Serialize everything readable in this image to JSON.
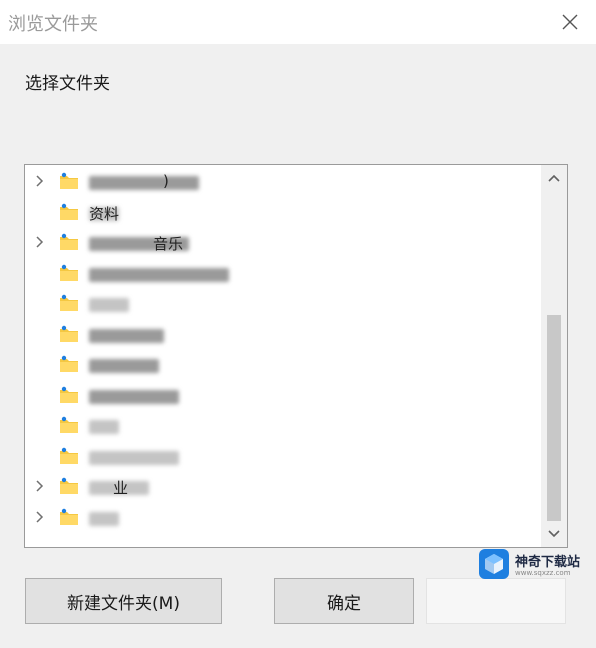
{
  "window": {
    "title": "浏览文件夹"
  },
  "dialog": {
    "prompt": "选择文件夹"
  },
  "tree": {
    "rows": [
      {
        "expandable": true,
        "label": ")",
        "blur": 110,
        "dark": true
      },
      {
        "expandable": false,
        "label": "资料",
        "blur": 30,
        "dark": false
      },
      {
        "expandable": true,
        "label": "音乐",
        "blur": 100,
        "dark": true
      },
      {
        "expandable": false,
        "label": "",
        "blur": 140,
        "dark": true
      },
      {
        "expandable": false,
        "label": "",
        "blur": 40,
        "dark": false
      },
      {
        "expandable": false,
        "label": "",
        "blur": 75,
        "dark": true
      },
      {
        "expandable": false,
        "label": "",
        "blur": 70,
        "dark": true
      },
      {
        "expandable": false,
        "label": "",
        "blur": 90,
        "dark": true
      },
      {
        "expandable": false,
        "label": "",
        "blur": 30,
        "dark": false
      },
      {
        "expandable": false,
        "label": "",
        "blur": 90,
        "dark": false
      },
      {
        "expandable": true,
        "label": "业",
        "blur": 60,
        "dark": false
      },
      {
        "expandable": true,
        "label": "",
        "blur": 30,
        "dark": false
      }
    ]
  },
  "buttons": {
    "new_folder": "新建文件夹(M)",
    "ok": "确定",
    "cancel": ""
  },
  "watermark": {
    "name": "神奇下载站",
    "url": "www.sqxzz.com"
  },
  "colors": {
    "folder": "#f5c842",
    "accent": "#1e7fe0"
  }
}
